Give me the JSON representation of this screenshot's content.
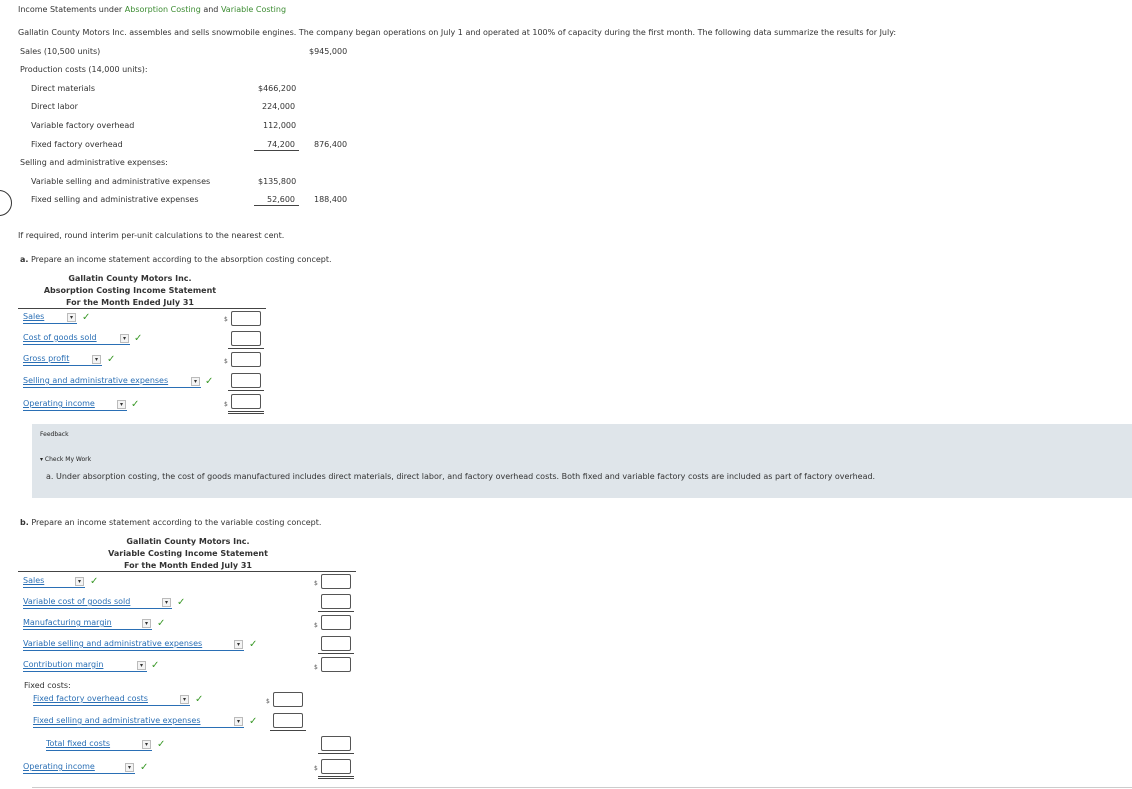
{
  "header": {
    "title_prefix": "Income Statements under",
    "link_absorption": "Absorption Costing",
    "and": "and",
    "link_variable": "Variable Costing"
  },
  "intro": "Gallatin County Motors Inc. assembles and sells snowmobile engines. The company began operations on July 1 and operated at 100% of capacity during the first month. The following data summarize the results for July:",
  "data_table": {
    "sales_label": "Sales (10,500 units)",
    "sales_value": "$945,000",
    "production_label": "Production costs (14,000 units):",
    "direct_materials_label": "Direct materials",
    "direct_materials_value": "$466,200",
    "direct_labor_label": "Direct labor",
    "direct_labor_value": "224,000",
    "variable_overhead_label": "Variable factory overhead",
    "variable_overhead_value": "112,000",
    "fixed_overhead_label": "Fixed factory overhead",
    "fixed_overhead_value": "74,200",
    "production_total": "876,400",
    "sa_label": "Selling and administrative expenses:",
    "variable_sa_label": "Variable selling and administrative expenses",
    "variable_sa_value": "$135,800",
    "fixed_sa_label": "Fixed selling and administrative expenses",
    "fixed_sa_value": "52,600",
    "sa_total": "188,400"
  },
  "rounding_note": "If required, round interim per-unit calculations to the nearest cent.",
  "part_a": {
    "prompt_letter": "a.",
    "prompt": "Prepare an income statement according to the absorption costing concept.",
    "company": "Gallatin County Motors Inc.",
    "statement_title": "Absorption Costing Income Statement",
    "period": "For the Month Ended July 31",
    "rows": {
      "sales": "Sales",
      "cogs": "Cost of goods sold",
      "gross_profit": "Gross profit",
      "sa_expenses": "Selling and administrative expenses",
      "operating_income": "Operating income"
    }
  },
  "feedback": {
    "label": "Feedback",
    "toggle": "▾ Check My Work",
    "text": "a. Under absorption costing, the cost of goods manufactured includes direct materials, direct labor, and factory overhead costs. Both fixed and variable factory costs are included as part of factory overhead."
  },
  "part_b": {
    "prompt_letter": "b.",
    "prompt": "Prepare an income statement according to the variable costing concept.",
    "company": "Gallatin County Motors Inc.",
    "statement_title": "Variable Costing Income Statement",
    "period": "For the Month Ended July 31",
    "rows": {
      "sales": "Sales",
      "variable_cogs": "Variable cost of goods sold",
      "manufacturing_margin": "Manufacturing margin",
      "variable_sa": "Variable selling and administrative expenses",
      "contribution_margin": "Contribution margin",
      "fixed_costs_label": "Fixed costs:",
      "fixed_factory_overhead": "Fixed factory overhead costs",
      "fixed_sa": "Fixed selling and administrative expenses",
      "total_fixed_costs": "Total fixed costs",
      "operating_income": "Operating income"
    }
  },
  "symbols": {
    "dollar": "$",
    "check": "✓",
    "dropdown_arrow": "▾"
  },
  "colors": {
    "link_green": "#3c8c32",
    "dropdown_blue": "#2a6fb5",
    "check_green": "#3c9a2a",
    "feedback_bg": "#dfe5ea"
  },
  "icons": [
    "check-icon",
    "dropdown-arrow-icon",
    "collapse-arrow-icon"
  ]
}
